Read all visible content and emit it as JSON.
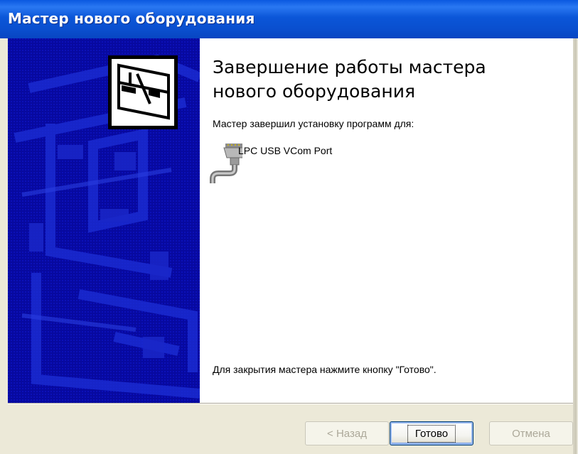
{
  "window": {
    "title": "Мастер нового оборудования"
  },
  "content": {
    "heading": "Завершение работы мастера нового оборудования",
    "intro": "Мастер завершил установку программ для:",
    "device": {
      "icon": "serial-port-icon",
      "name": "LPC USB VCom Port"
    },
    "footer": "Для закрытия мастера нажмите кнопку \"Готово\"."
  },
  "buttons": {
    "back_label": "< Назад",
    "finish_label": "Готово",
    "cancel_label": "Отмена"
  },
  "banner": {
    "icon": "hardware-wizard-icon"
  },
  "colors": {
    "titlebar": "#0a4fcf",
    "banner": "#07099f",
    "dialog": "#ece9d8"
  }
}
